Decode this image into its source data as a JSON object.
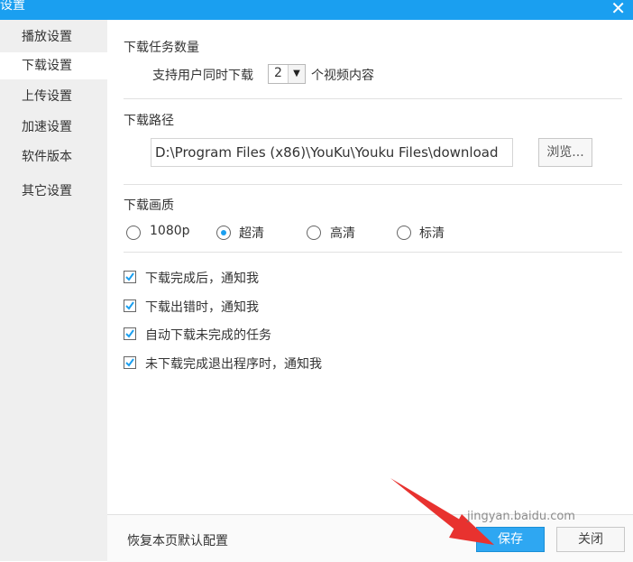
{
  "window": {
    "title": "设置",
    "close_icon": "close-icon",
    "accent_color": "#1a9ff0"
  },
  "sidebar": {
    "items": [
      {
        "label": "播放设置",
        "active": false
      },
      {
        "label": "下载设置",
        "active": true
      },
      {
        "label": "上传设置",
        "active": false
      },
      {
        "label": "加速设置",
        "active": false
      },
      {
        "label": "软件版本",
        "active": false
      },
      {
        "label": "其它设置",
        "active": false
      }
    ]
  },
  "download_count": {
    "title": "下载任务数量",
    "prefix": "支持用户同时下载",
    "value": "2",
    "suffix": "个视频内容"
  },
  "download_path": {
    "title": "下载路径",
    "value": "D:\\Program Files (x86)\\YouKu\\Youku Files\\download",
    "browse_label": "浏览..."
  },
  "quality": {
    "title": "下载画质",
    "options": [
      {
        "label": "1080p",
        "selected": false
      },
      {
        "label": "超清",
        "selected": true
      },
      {
        "label": "高清",
        "selected": false
      },
      {
        "label": "标清",
        "selected": false
      }
    ]
  },
  "notifications": [
    {
      "label": "下载完成后，通知我",
      "checked": true
    },
    {
      "label": "下载出错时，通知我",
      "checked": true
    },
    {
      "label": "自动下载未完成的任务",
      "checked": true
    },
    {
      "label": "未下载完成退出程序时，通知我",
      "checked": true
    }
  ],
  "footer": {
    "restore_label": "恢复本页默认配置",
    "save_label": "保存",
    "close_label": "关闭",
    "save_color": "#2ea7f2"
  },
  "overlay": {
    "arrow_color": "#e8322f",
    "watermark": "jingyan.baidu.com"
  }
}
